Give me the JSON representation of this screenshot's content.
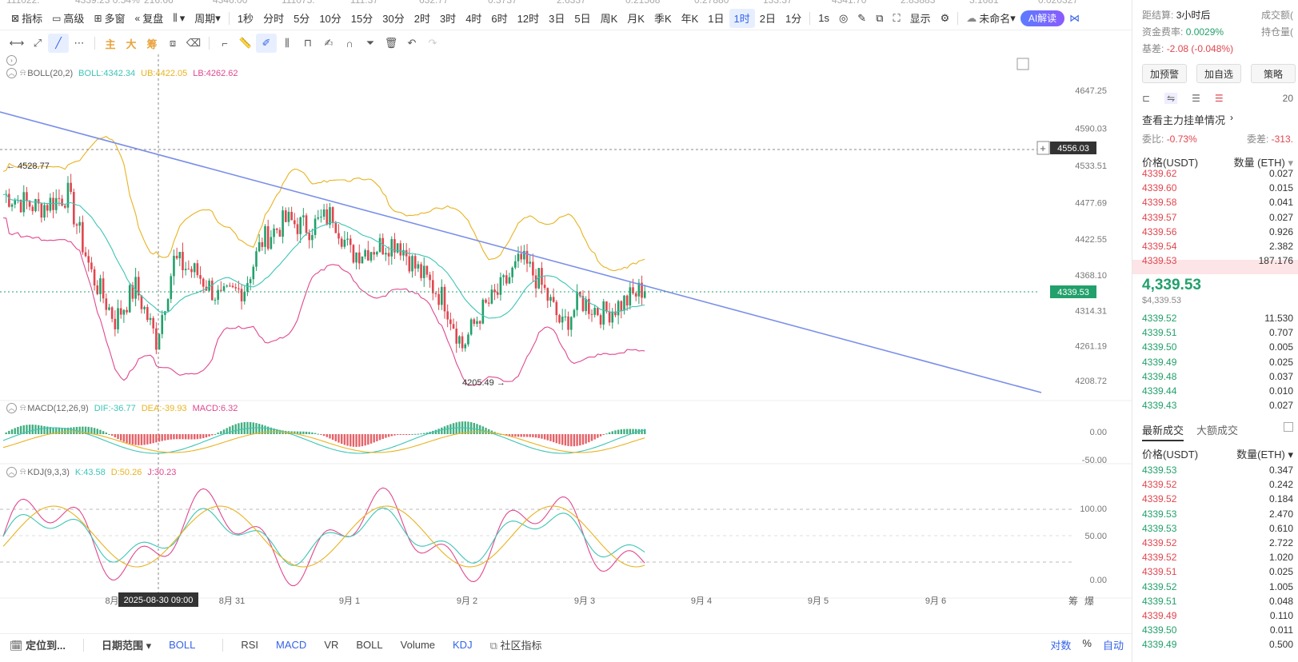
{
  "colors": {
    "up": "#22a06b",
    "down": "#e0464e",
    "accent": "#3563e9",
    "boll_mid": "#3ec5b6",
    "boll_up": "#e8b321",
    "boll_low": "#e0488f",
    "trend": "#7b8fe8"
  },
  "ticker": [
    "111022.",
    "4339.23 0.54%",
    "216.66",
    "4346.00",
    "111075.",
    "111.37",
    "632.77",
    "0.3737",
    "2.6337",
    "0.21568",
    "0.27880",
    "133.37",
    "4341.70",
    "2.83883",
    "3.1681",
    "0.020327"
  ],
  "toolbar": {
    "indicators": "指标",
    "advanced": "高级",
    "multi_window": "多窗",
    "replay": "复盘",
    "period_menu": "周期",
    "periods": [
      "1秒",
      "分时",
      "5分",
      "10分",
      "15分",
      "30分",
      "2时",
      "3时",
      "4时",
      "6时",
      "12时",
      "3日",
      "5日",
      "周K",
      "月K",
      "季K",
      "年K",
      "1日",
      "1时",
      "2日",
      "1分"
    ],
    "active_period": "1时",
    "one_second": "1s",
    "display": "显示",
    "unnamed": "未命名",
    "ai": "AI解读"
  },
  "draw_tools": {
    "main": "主",
    "big": "大",
    "chip": "筹"
  },
  "boll": {
    "name": "BOLL(20,2)",
    "boll": "BOLL:4342.34",
    "ub": "UB:4422.05",
    "lb": "LB:4262.62"
  },
  "macd": {
    "name": "MACD(12,26,9)",
    "dif": "DIF:-36.77",
    "dea": "DEA:-39.93",
    "macd": "MACD:6.32"
  },
  "kdj": {
    "name": "KDJ(9,3,3)",
    "k": "K:43.58",
    "d": "D:50.26",
    "j": "J:30.23"
  },
  "price_axis": [
    "4647.25",
    "4590.03",
    "4533.51",
    "4477.69",
    "4422.55",
    "4368.10",
    "4314.31",
    "4261.19",
    "4208.72"
  ],
  "macd_axis": [
    "0.00",
    "-50.00"
  ],
  "kdj_axis": [
    "100.00",
    "50.00",
    "0.00"
  ],
  "crosshair_price": "4556.03",
  "current_price_tag": "4339.53",
  "high_marker": "4528.77",
  "low_marker": "4205.49",
  "date_axis": [
    "8月",
    "8月 31",
    "9月 1",
    "9月 2",
    "9月 3",
    "9月 4",
    "9月 5",
    "9月 6"
  ],
  "crosshair_time": "2025-08-30 09:00",
  "axis_corner": [
    "筹",
    "爆"
  ],
  "bottom": {
    "locate": "定位到...",
    "date_range": "日期范围",
    "tabs": [
      "BOLL",
      "RSI",
      "MACD",
      "VR",
      "BOLL",
      "Volume",
      "KDJ"
    ],
    "community": "社区指标",
    "log": "对数",
    "pct": "%",
    "auto": "自动"
  },
  "panel": {
    "settle_label": "距结算:",
    "settle_value": "3小时后",
    "volume_label": "成交额(",
    "funding_label": "资金费率:",
    "funding_value": "0.0029%",
    "oi_label": "持仓量(",
    "basis_label": "基差:",
    "basis_value": "-2.08 (-0.048%)",
    "btn_alert": "加预警",
    "btn_fav": "加自选",
    "btn_strategy": "策略",
    "depth_num": "20",
    "view_orders": "查看主力挂单情况",
    "ratio_label": "委比:",
    "ratio_value": "-0.73%",
    "diff_label": "委差:",
    "diff_value": "-313.",
    "book_price_hdr": "价格(USDT)",
    "book_qty_hdr": "数量 (ETH)",
    "asks": [
      [
        "4339.62",
        "0.027"
      ],
      [
        "4339.60",
        "0.015"
      ],
      [
        "4339.58",
        "0.041"
      ],
      [
        "4339.57",
        "0.027"
      ],
      [
        "4339.56",
        "0.926"
      ],
      [
        "4339.54",
        "2.382"
      ],
      [
        "4339.53",
        "187.176"
      ]
    ],
    "last_price": "4,339.53",
    "last_price_usd": "$4,339.53",
    "bids": [
      [
        "4339.52",
        "11.530"
      ],
      [
        "4339.51",
        "0.707"
      ],
      [
        "4339.50",
        "0.005"
      ],
      [
        "4339.49",
        "0.025"
      ],
      [
        "4339.48",
        "0.037"
      ],
      [
        "4339.44",
        "0.010"
      ],
      [
        "4339.43",
        "0.027"
      ]
    ],
    "tab_latest": "最新成交",
    "tab_big": "大额成交",
    "trade_price_hdr": "价格(USDT)",
    "trade_qty_hdr": "数量(ETH)",
    "trades": [
      [
        "4339.53",
        "0.347",
        "up"
      ],
      [
        "4339.52",
        "0.242",
        "down"
      ],
      [
        "4339.52",
        "0.184",
        "down"
      ],
      [
        "4339.53",
        "2.470",
        "up"
      ],
      [
        "4339.53",
        "0.610",
        "up"
      ],
      [
        "4339.52",
        "2.722",
        "down"
      ],
      [
        "4339.52",
        "1.020",
        "down"
      ],
      [
        "4339.51",
        "0.025",
        "down"
      ],
      [
        "4339.52",
        "1.005",
        "up"
      ],
      [
        "4339.51",
        "0.048",
        "up"
      ],
      [
        "4339.49",
        "0.110",
        "down"
      ],
      [
        "4339.50",
        "0.011",
        "up"
      ],
      [
        "4339.49",
        "0.500",
        "up"
      ]
    ]
  }
}
